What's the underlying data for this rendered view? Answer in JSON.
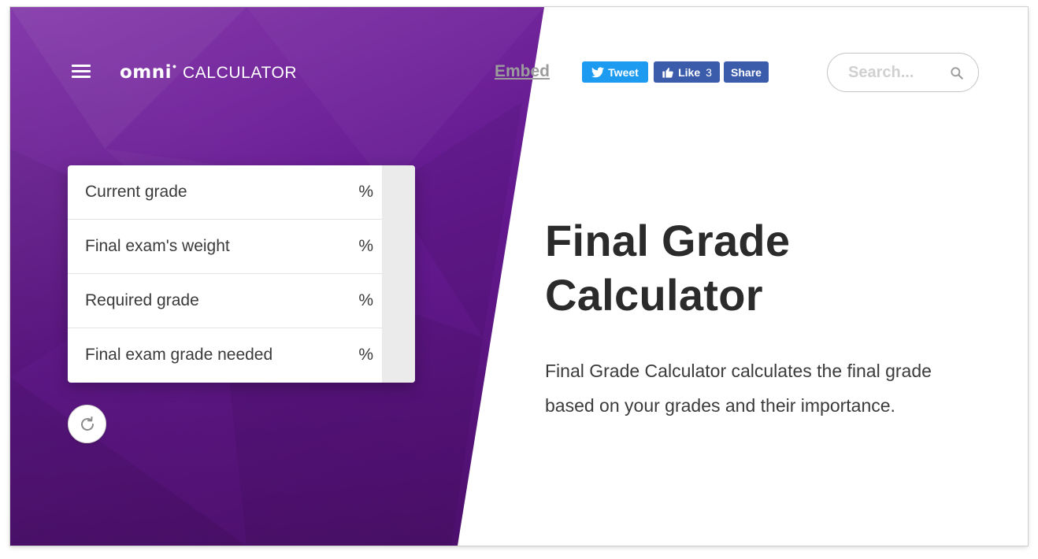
{
  "header": {
    "logo_brand": "omni",
    "logo_product": "CALCULATOR",
    "embed_label": "Embed",
    "tweet_label": "Tweet",
    "like_label": "Like",
    "like_count": "3",
    "share_label": "Share",
    "search_placeholder": "Search..."
  },
  "calculator": {
    "rows": [
      {
        "label": "Current grade",
        "unit": "%"
      },
      {
        "label": "Final exam's weight",
        "unit": "%"
      },
      {
        "label": "Required grade",
        "unit": "%"
      },
      {
        "label": "Final exam grade needed",
        "unit": "%"
      }
    ],
    "reset_icon": "refresh-icon"
  },
  "main": {
    "title": "Final Grade Calculator",
    "description": "Final Grade Calculator calculates the final grade based on your grades and their importance."
  },
  "colors": {
    "purple_dark": "#480e66",
    "purple_light": "#7e2ea6",
    "twitter_blue": "#1d9bf0",
    "facebook_blue": "#3b5bab",
    "title_text": "#2b2b2b"
  },
  "icons": [
    "menu-icon",
    "twitter-bird-icon",
    "thumbs-up-icon",
    "search-icon",
    "refresh-icon"
  ]
}
